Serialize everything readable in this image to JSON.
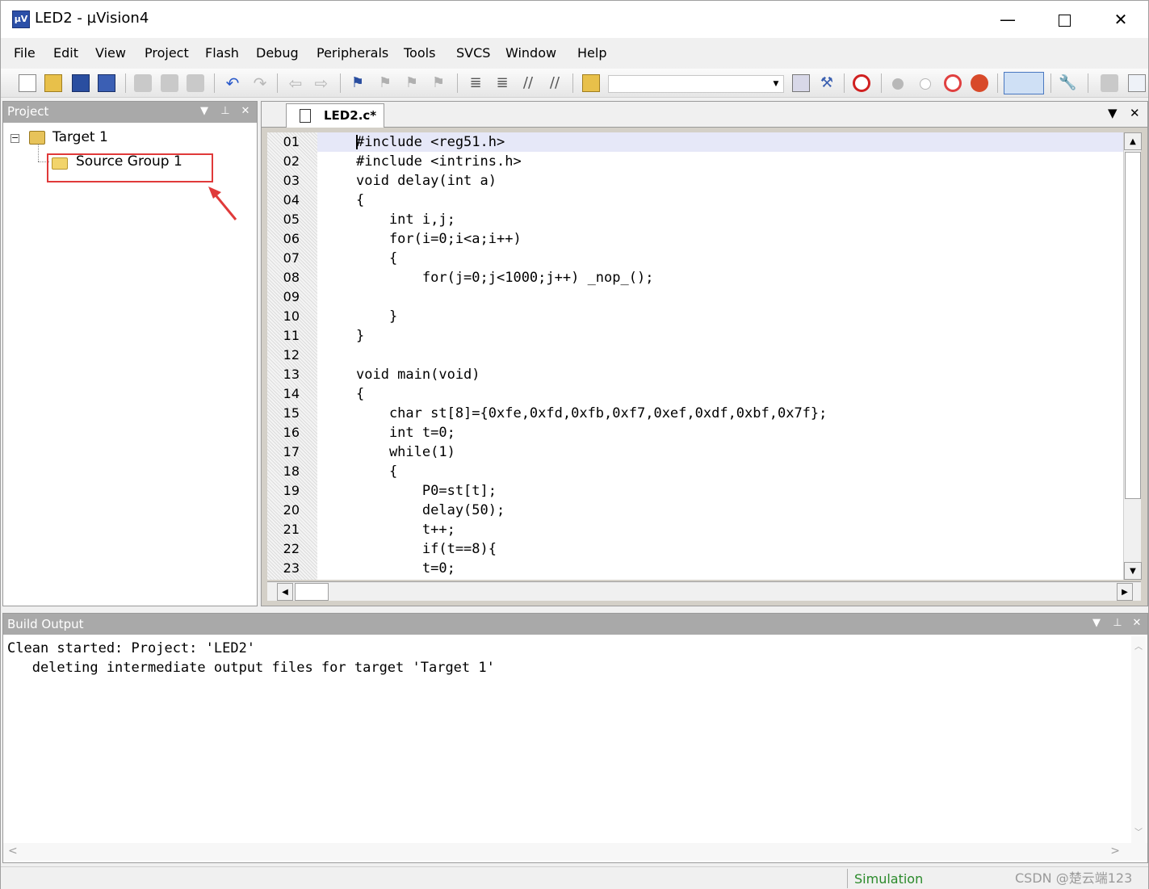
{
  "window": {
    "title": "LED2  - µVision4",
    "app_icon": "µV",
    "controls": {
      "minimize": "—",
      "close": "✕"
    }
  },
  "menu": [
    "File",
    "Edit",
    "View",
    "Project",
    "Flash",
    "Debug",
    "Peripherals",
    "Tools",
    "SVCS",
    "Window",
    "Help"
  ],
  "toolbar": {
    "icons": [
      "new-file-icon",
      "open-folder-icon",
      "save-icon",
      "save-all-icon",
      "cut-icon",
      "copy-icon",
      "paste-icon",
      "undo-icon",
      "redo-icon",
      "nav-back-icon",
      "nav-forward-icon",
      "bookmark-icon",
      "bookmark-prev-icon",
      "bookmark-next-icon",
      "bookmark-clear-icon",
      "indent-icon",
      "unindent-icon",
      "comment-icon",
      "uncomment-icon",
      "find-in-files-icon",
      "find-icon",
      "incremental-find-icon",
      "start-debug-icon",
      "breakpoint-icon",
      "disable-breakpoint-icon",
      "disable-all-breakpoints-icon",
      "kill-breakpoints-icon",
      "window-layout-icon",
      "configure-icon",
      "load-icon",
      "rebuild-icon"
    ],
    "target_combo_value": ""
  },
  "project_panel": {
    "title": "Project",
    "tree": {
      "target": "Target 1",
      "group": "Source Group 1"
    }
  },
  "editor": {
    "tab_label": "LED2.c*",
    "line_numbers": [
      "01",
      "02",
      "03",
      "04",
      "05",
      "06",
      "07",
      "08",
      "09",
      "10",
      "11",
      "12",
      "13",
      "14",
      "15",
      "16",
      "17",
      "18",
      "19",
      "20",
      "21",
      "22",
      "23"
    ],
    "code_lines": [
      "#include <reg51.h>",
      "#include <intrins.h>",
      "void delay(int a)",
      "{",
      "    int i,j;",
      "    for(i=0;i<a;i++)",
      "    {",
      "        for(j=0;j<1000;j++) _nop_();",
      "",
      "    }",
      "}",
      "",
      "void main(void)",
      "{",
      "    char st[8]={0xfe,0xfd,0xfb,0xf7,0xef,0xdf,0xbf,0x7f};",
      "    int t=0;",
      "    while(1)",
      "    {",
      "        P0=st[t];",
      "        delay(50);",
      "        t++;",
      "        if(t==8){",
      "        t=0;"
    ]
  },
  "build_output": {
    "title": "Build Output",
    "lines": [
      "Clean started: Project: 'LED2'",
      "   deleting intermediate output files for target 'Target 1'"
    ]
  },
  "status": {
    "mode": "Simulation"
  },
  "watermark": "CSDN @楚云端123",
  "colors": {
    "panel_header": "#a9a9a9",
    "highlight_box": "#e03a3a",
    "current_line": "#e6e8f8",
    "status_green": "#2a8a2a"
  }
}
